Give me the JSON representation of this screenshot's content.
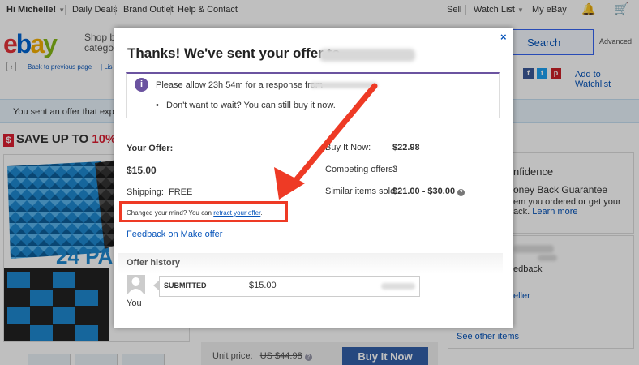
{
  "topbar": {
    "greeting": "Hi Michelle!",
    "daily_deals": "Daily Deals",
    "brand_outlet": "Brand Outlet",
    "help_contact": "Help & Contact",
    "sell": "Sell",
    "watch_list": "Watch List",
    "my_ebay": "My eBay"
  },
  "header": {
    "logo": "ebay",
    "shop_by": "Shop by",
    "category": "categor",
    "search_label": "Search",
    "advanced": "Advanced"
  },
  "subnav": {
    "back": "Back to previous page",
    "extra": "Lis",
    "add_to_watchlist": "Add to Watchlist"
  },
  "banner": {
    "text": "You sent an offer that expires"
  },
  "promo": {
    "save_up": "SAVE UP TO",
    "pct": "10%",
    "pack_text": "24 PA"
  },
  "right_panel": {
    "confidence": "nfidence",
    "guarantee": "oney Back Guarantee",
    "line1": "em you ordered or get your",
    "line2": "ack.",
    "learn_more": "Learn more",
    "feedback": "edback",
    "seller": "eller",
    "see_other": "See other items"
  },
  "buy": {
    "unit_price_label": "Unit price:",
    "unit_price": "US $44.98",
    "buy_button": "Buy It Now"
  },
  "modal": {
    "title": "Thanks! We've sent your offer to",
    "info_line1": "Please allow 23h 54m for a response from",
    "info_line2": "Don't want to wait? You can still buy it now.",
    "your_offer_label": "Your Offer:",
    "offer_amount": "$15.00",
    "shipping_label": "Shipping:",
    "shipping_value": "FREE",
    "changed_mind": "Changed your mind? You can",
    "retract_link": "retract your offer",
    "changed_end": ".",
    "feedback_link": "Feedback on Make offer",
    "bin_label": "Buy It Now:",
    "bin_value": "$22.98",
    "competing_label": "Competing offers:",
    "competing_value": "3",
    "similar_label": "Similar items sold:",
    "similar_value": "$21.00 - $30.00",
    "history_label": "Offer history",
    "history_status": "SUBMITTED",
    "history_amount": "$15.00",
    "you": "You",
    "close": "×"
  },
  "colors": {
    "accent_red": "#ee3a25",
    "purple": "#6b53a0",
    "link_blue": "#0654ba"
  }
}
